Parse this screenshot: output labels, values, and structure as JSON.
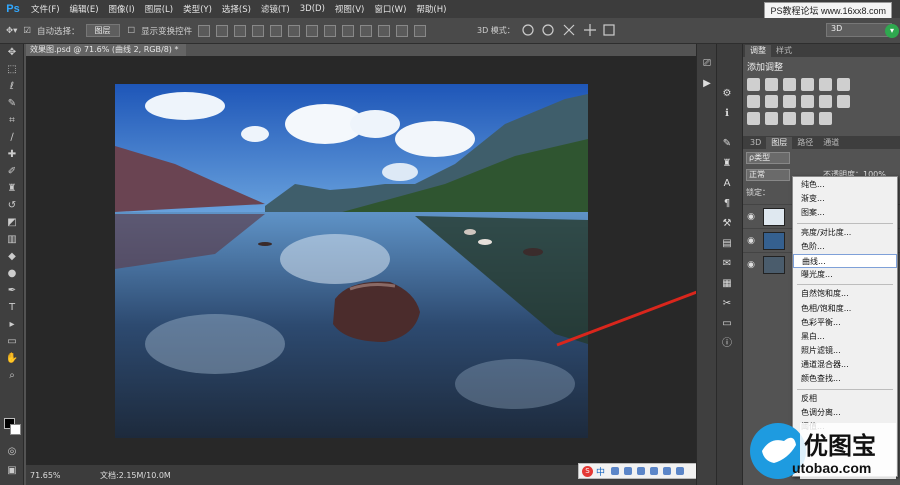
{
  "app": {
    "logo": "Ps"
  },
  "menubar": [
    "文件(F)",
    "编辑(E)",
    "图像(I)",
    "图层(L)",
    "类型(Y)",
    "选择(S)",
    "滤镜(T)",
    "3D(D)",
    "视图(V)",
    "窗口(W)",
    "帮助(H)"
  ],
  "watermark_top": "PS教程论坛 www.16xx8.com",
  "options": {
    "auto_select_label": "自动选择：",
    "auto_select_value": "图层",
    "show_transform": "显示变换控件",
    "mode_3d": "3D 模式：",
    "workspace": "3D"
  },
  "document": {
    "tab_title": "效果图.psd @ 71.6% (曲线 2, RGB/8) *",
    "zoom": "71.65%",
    "doc_size": "文档:2.15M/10.0M"
  },
  "ime": {
    "lang": "中"
  },
  "panel": {
    "tabs_top": [
      "调整",
      "样式"
    ],
    "adj_title": "添加调整",
    "tabs_layers": [
      "3D",
      "图层",
      "路径",
      "通道"
    ],
    "kind": "ρ类型",
    "blend": "正常",
    "opacity": "不透明度：100%",
    "lock": "锁定："
  },
  "context_menu": {
    "items": [
      "纯色...",
      "渐变...",
      "图案...",
      "",
      "亮度/对比度...",
      "色阶...",
      "曲线...",
      "曝光度...",
      "",
      "自然饱和度...",
      "色相/饱和度...",
      "色彩平衡...",
      "黑白...",
      "照片滤镜...",
      "通道混合器...",
      "颜色查找...",
      "",
      "反相",
      "色调分离...",
      "阈值..."
    ],
    "highlighted": "曲线..."
  },
  "watermark": {
    "name": "优图宝",
    "url": "utobao.com"
  },
  "colors": {
    "accent": "#31a8ff",
    "arrow": "#d9261c",
    "watermark_blue": "#1e9be0"
  }
}
